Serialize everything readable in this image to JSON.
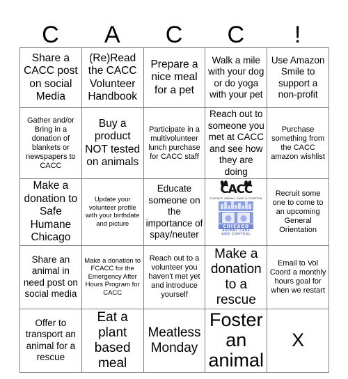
{
  "card": {
    "title_letters": [
      "C",
      "A",
      "C",
      "C",
      "!"
    ],
    "rows": [
      [
        {
          "text": "Share a CACC post on social Media",
          "size": "s-lg"
        },
        {
          "text": "(Re)Read the CACC Volunteer Handbook",
          "size": "s-lg"
        },
        {
          "text": "Prepare a nice meal for a pet",
          "size": "s-lg"
        },
        {
          "text": "Walk a mile with your dog or do yoga with your pet",
          "size": "s-md"
        },
        {
          "text": "Use Amazon Smile to support a non-profit",
          "size": "s-md"
        }
      ],
      [
        {
          "text": "Gather and/or Bring in a donation of blankets or newspapers to CACC",
          "size": "s-sm"
        },
        {
          "text": "Buy a product NOT tested on animals",
          "size": "s-lg"
        },
        {
          "text": "Participate in a multivolunteer lunch purchase for CACC staff",
          "size": "s-sm"
        },
        {
          "text": "Reach out to someone you met at CACC and see how they are doing",
          "size": "s-md"
        },
        {
          "text": "Purchase something from the CACC amazon wishlist",
          "size": "s-sm"
        }
      ],
      [
        {
          "text": "Make a donation to Safe Humane Chicago",
          "size": "s-lg"
        },
        {
          "text": "Update your volunteer profile with your birthdate and picture",
          "size": "s-xs"
        },
        {
          "text": "Educate someone on the importance of spay/neuter",
          "size": "s-md"
        },
        {
          "text": "",
          "size": "free",
          "is_free": true
        },
        {
          "text": "Recruit some one to come to an upcoming General Orientation",
          "size": "s-sm"
        }
      ],
      [
        {
          "text": "Share an animal in need post on social media",
          "size": "s-md"
        },
        {
          "text": "Make a donation to FCACC for the Emergency After Hours Program for CACC",
          "size": "s-xs"
        },
        {
          "text": "Reach out to a volunteer you haven't met yet and introduce yourself",
          "size": "s-sm"
        },
        {
          "text": "Make a donation to a rescue",
          "size": "s-xl"
        },
        {
          "text": "Email to Vol Coord a monthly hours goal for when we restart",
          "size": "s-sm"
        }
      ],
      [
        {
          "text": "Offer to transport an animal for a rescue",
          "size": "s-md"
        },
        {
          "text": "Eat a plant based meal",
          "size": "s-xl"
        },
        {
          "text": "Meatless Monday",
          "size": "s-xl"
        },
        {
          "text": "Foster an animal",
          "size": "s-xxl"
        },
        {
          "text": "X",
          "size": "s-xxl"
        }
      ]
    ],
    "free_space_logo": {
      "wordmark": "CACC",
      "tagline": "CHICAGO ANIMAL CARE & CONTROL",
      "badge_city": "CHICAGO",
      "badge_sub": "ANIMAL CARE\nAND CONTROL"
    },
    "colors": {
      "grid_line": "#808080",
      "text": "#000000",
      "logo_blue": "#6f85d4",
      "logo_blue_light": "#8c9fe0",
      "background": "#ffffff"
    }
  }
}
